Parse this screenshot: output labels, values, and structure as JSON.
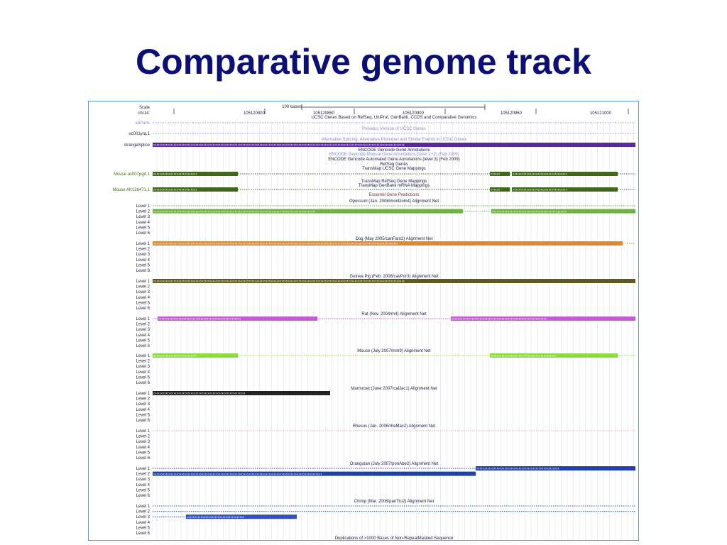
{
  "slide": {
    "title": "Comparative genome track"
  },
  "browser": {
    "scale_label": "Scale",
    "chrom_label": "chr14:",
    "scale_bar_label": "100 bases",
    "positions": [
      "105120800",
      "105120850",
      "105120900",
      "105120950",
      "105121000"
    ],
    "colors": {
      "frame_border": "#5aa0d8",
      "grid": "#dbe3ec",
      "ucsc_blue": "#8e90cc",
      "strange_purple": "#5a2a96",
      "transmap_green": "#3e6a18",
      "opossum_green": "#6eb43c",
      "dog_orange": "#d98a3a",
      "guinea_olive": "#5e5a20",
      "rat_magenta": "#c85ad8",
      "mouse_lime": "#8ade3a",
      "marmoset_black": "#222222",
      "rhesus_pink": "#e8a8a8",
      "orangutan_blue": "#2040b0",
      "chimp_blue": "#3050c0",
      "label_dark": "#222244",
      "label_red": "#8a3030",
      "label_light": "#8b8bc8"
    },
    "annotation_tracks": [
      {
        "label": "abParts",
        "style": "light"
      },
      {
        "label": "uc001yrq.1",
        "style": "normal"
      },
      {
        "label": "strangeSplice",
        "style": "normal"
      },
      {
        "label": "Mouse uc007pgd.1",
        "style": "green"
      },
      {
        "label": "Mouse AK136471.1",
        "style": "green"
      }
    ],
    "section_titles": [
      {
        "text": "UCSC Genes Based on RefSeq, UniProt, GenBank, CCDS and Comparative Genomics",
        "style": "dark"
      },
      {
        "text": "Previous Version of UCSC Genes",
        "style": "light"
      },
      {
        "text": "Alternative Splicing, Alternative Promoter and Similar Events in UCSC Genes",
        "style": "light"
      },
      {
        "text": "ENCODE Gencode Gene Annotations",
        "style": "dark"
      },
      {
        "text": "ENCODE Gencode Manual Gene Annotations (level 1+2) (Feb 2009)",
        "style": "light"
      },
      {
        "text": "ENCODE Gencode Automated Gene Annotations (level 3) (Feb 2009)",
        "style": "dark"
      },
      {
        "text": "RefSeq Genes",
        "style": "dark"
      },
      {
        "text": "TransMap UCSC Gene Mappings",
        "style": "dark"
      },
      {
        "text": "TransMap RefSeq Gene Mappings",
        "style": "dark"
      },
      {
        "text": "TransMap GenBank mRNA Mappings",
        "style": "dark"
      },
      {
        "text": "Ensembl Gene Predictions",
        "style": "red"
      }
    ],
    "level_labels": [
      "Level 1",
      "Level 2",
      "Level 3",
      "Level 4",
      "Level 5",
      "Level 6"
    ],
    "alignment_nets": [
      {
        "title": "Opossum (Jan. 2006/monDom4) Alignment Net"
      },
      {
        "title": "Dog (May 2005/canFam2) Alignment Net"
      },
      {
        "title": "Guinea Pig (Feb. 2008/cavPor3) Alignment Net"
      },
      {
        "title": "Rat (Nov. 2004/rn4) Alignment Net"
      },
      {
        "title": "Mouse (July 2007/mm9) Alignment Net"
      },
      {
        "title": "Marmoset (June 2007/calJac1) Alignment Net"
      },
      {
        "title": "Rhesus (Jan. 2006/rheMac2) Alignment Net"
      },
      {
        "title": "Orangutan (July 2007/ponAbe2) Alignment Net"
      },
      {
        "title": "Chimp (Mar. 2006/panTro2) Alignment Net"
      }
    ],
    "footer_title": "Duplications of >1000 Bases of Non-RepeatMasked Sequence"
  }
}
